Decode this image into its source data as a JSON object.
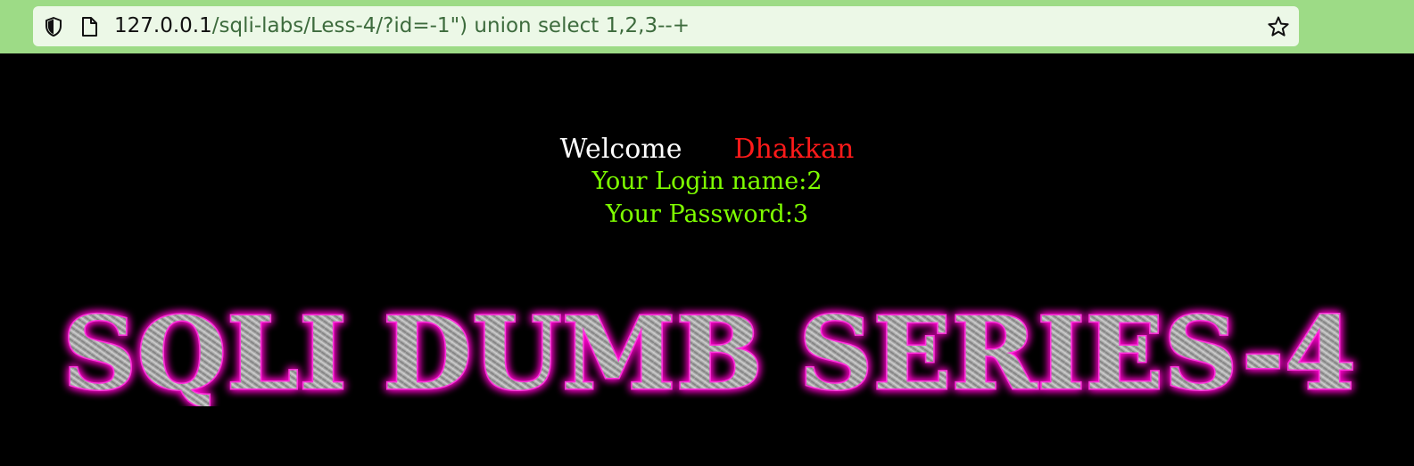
{
  "browser": {
    "url_host": "127.0.0.1",
    "url_path": "/sqli-labs/Less-4/?id=-1\") union select 1,2,3--+",
    "icons": {
      "shield": "shield-icon",
      "page": "page-icon",
      "star": "star-icon"
    }
  },
  "page": {
    "welcome_word": "Welcome",
    "welcome_name": "Dhakkan",
    "login_line": "Your Login name:2",
    "password_line": "Your Password:3",
    "banner_text": "SQLI DUMB SERIES-4"
  },
  "colors": {
    "chrome_bg": "#9ddb86",
    "url_bar_bg": "#ecf8e7",
    "page_bg": "#000000",
    "welcome_white": "#ffffff",
    "name_red": "#ff1a1a",
    "info_green": "#7fff00",
    "banner_glow": "#ff00cc",
    "banner_fill": "#9a9a9a"
  }
}
